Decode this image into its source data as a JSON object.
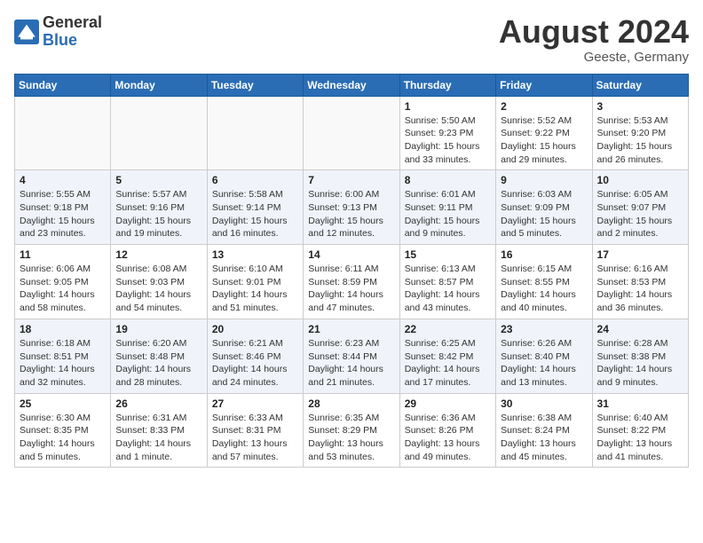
{
  "header": {
    "logo_general": "General",
    "logo_blue": "Blue",
    "month_year": "August 2024",
    "location": "Geeste, Germany"
  },
  "weekdays": [
    "Sunday",
    "Monday",
    "Tuesday",
    "Wednesday",
    "Thursday",
    "Friday",
    "Saturday"
  ],
  "weeks": [
    [
      {
        "day": "",
        "info": ""
      },
      {
        "day": "",
        "info": ""
      },
      {
        "day": "",
        "info": ""
      },
      {
        "day": "",
        "info": ""
      },
      {
        "day": "1",
        "info": "Sunrise: 5:50 AM\nSunset: 9:23 PM\nDaylight: 15 hours\nand 33 minutes."
      },
      {
        "day": "2",
        "info": "Sunrise: 5:52 AM\nSunset: 9:22 PM\nDaylight: 15 hours\nand 29 minutes."
      },
      {
        "day": "3",
        "info": "Sunrise: 5:53 AM\nSunset: 9:20 PM\nDaylight: 15 hours\nand 26 minutes."
      }
    ],
    [
      {
        "day": "4",
        "info": "Sunrise: 5:55 AM\nSunset: 9:18 PM\nDaylight: 15 hours\nand 23 minutes."
      },
      {
        "day": "5",
        "info": "Sunrise: 5:57 AM\nSunset: 9:16 PM\nDaylight: 15 hours\nand 19 minutes."
      },
      {
        "day": "6",
        "info": "Sunrise: 5:58 AM\nSunset: 9:14 PM\nDaylight: 15 hours\nand 16 minutes."
      },
      {
        "day": "7",
        "info": "Sunrise: 6:00 AM\nSunset: 9:13 PM\nDaylight: 15 hours\nand 12 minutes."
      },
      {
        "day": "8",
        "info": "Sunrise: 6:01 AM\nSunset: 9:11 PM\nDaylight: 15 hours\nand 9 minutes."
      },
      {
        "day": "9",
        "info": "Sunrise: 6:03 AM\nSunset: 9:09 PM\nDaylight: 15 hours\nand 5 minutes."
      },
      {
        "day": "10",
        "info": "Sunrise: 6:05 AM\nSunset: 9:07 PM\nDaylight: 15 hours\nand 2 minutes."
      }
    ],
    [
      {
        "day": "11",
        "info": "Sunrise: 6:06 AM\nSunset: 9:05 PM\nDaylight: 14 hours\nand 58 minutes."
      },
      {
        "day": "12",
        "info": "Sunrise: 6:08 AM\nSunset: 9:03 PM\nDaylight: 14 hours\nand 54 minutes."
      },
      {
        "day": "13",
        "info": "Sunrise: 6:10 AM\nSunset: 9:01 PM\nDaylight: 14 hours\nand 51 minutes."
      },
      {
        "day": "14",
        "info": "Sunrise: 6:11 AM\nSunset: 8:59 PM\nDaylight: 14 hours\nand 47 minutes."
      },
      {
        "day": "15",
        "info": "Sunrise: 6:13 AM\nSunset: 8:57 PM\nDaylight: 14 hours\nand 43 minutes."
      },
      {
        "day": "16",
        "info": "Sunrise: 6:15 AM\nSunset: 8:55 PM\nDaylight: 14 hours\nand 40 minutes."
      },
      {
        "day": "17",
        "info": "Sunrise: 6:16 AM\nSunset: 8:53 PM\nDaylight: 14 hours\nand 36 minutes."
      }
    ],
    [
      {
        "day": "18",
        "info": "Sunrise: 6:18 AM\nSunset: 8:51 PM\nDaylight: 14 hours\nand 32 minutes."
      },
      {
        "day": "19",
        "info": "Sunrise: 6:20 AM\nSunset: 8:48 PM\nDaylight: 14 hours\nand 28 minutes."
      },
      {
        "day": "20",
        "info": "Sunrise: 6:21 AM\nSunset: 8:46 PM\nDaylight: 14 hours\nand 24 minutes."
      },
      {
        "day": "21",
        "info": "Sunrise: 6:23 AM\nSunset: 8:44 PM\nDaylight: 14 hours\nand 21 minutes."
      },
      {
        "day": "22",
        "info": "Sunrise: 6:25 AM\nSunset: 8:42 PM\nDaylight: 14 hours\nand 17 minutes."
      },
      {
        "day": "23",
        "info": "Sunrise: 6:26 AM\nSunset: 8:40 PM\nDaylight: 14 hours\nand 13 minutes."
      },
      {
        "day": "24",
        "info": "Sunrise: 6:28 AM\nSunset: 8:38 PM\nDaylight: 14 hours\nand 9 minutes."
      }
    ],
    [
      {
        "day": "25",
        "info": "Sunrise: 6:30 AM\nSunset: 8:35 PM\nDaylight: 14 hours\nand 5 minutes."
      },
      {
        "day": "26",
        "info": "Sunrise: 6:31 AM\nSunset: 8:33 PM\nDaylight: 14 hours\nand 1 minute."
      },
      {
        "day": "27",
        "info": "Sunrise: 6:33 AM\nSunset: 8:31 PM\nDaylight: 13 hours\nand 57 minutes."
      },
      {
        "day": "28",
        "info": "Sunrise: 6:35 AM\nSunset: 8:29 PM\nDaylight: 13 hours\nand 53 minutes."
      },
      {
        "day": "29",
        "info": "Sunrise: 6:36 AM\nSunset: 8:26 PM\nDaylight: 13 hours\nand 49 minutes."
      },
      {
        "day": "30",
        "info": "Sunrise: 6:38 AM\nSunset: 8:24 PM\nDaylight: 13 hours\nand 45 minutes."
      },
      {
        "day": "31",
        "info": "Sunrise: 6:40 AM\nSunset: 8:22 PM\nDaylight: 13 hours\nand 41 minutes."
      }
    ]
  ]
}
